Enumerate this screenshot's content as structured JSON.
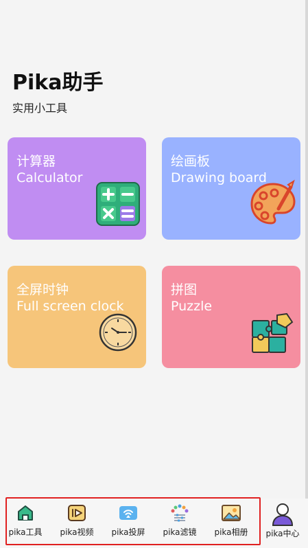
{
  "header": {
    "title": "Pika助手",
    "subtitle": "实用小工具"
  },
  "cards": [
    {
      "cn": "计算器",
      "en": "Calculator",
      "color": "#c08df2",
      "icon": "calculator-icon"
    },
    {
      "cn": "绘画板",
      "en": "Drawing board",
      "color": "#99b2ff",
      "icon": "palette-icon"
    },
    {
      "cn": "全屏时钟",
      "en": "Full screen clock",
      "color": "#f6c57a",
      "icon": "clock-icon"
    },
    {
      "cn": "拼图",
      "en": "Puzzle",
      "color": "#f58ea0",
      "icon": "puzzle-icon"
    }
  ],
  "nav": {
    "items": [
      {
        "label": "pika工具",
        "icon": "home-icon"
      },
      {
        "label": "pika视频",
        "icon": "video-icon"
      },
      {
        "label": "pika投屏",
        "icon": "cast-icon"
      },
      {
        "label": "pika滤镜",
        "icon": "filter-icon"
      },
      {
        "label": "pika相册",
        "icon": "album-icon"
      },
      {
        "label": "pika中心",
        "icon": "profile-icon"
      }
    ],
    "highlight_color": "#e02020"
  }
}
